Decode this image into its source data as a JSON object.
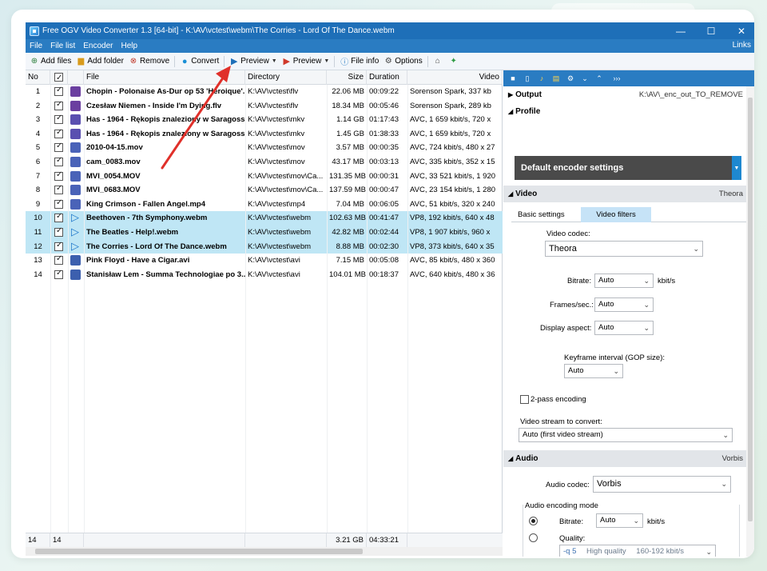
{
  "window": {
    "title": "Free OGV Video Converter 1.3  [64-bit] - K:\\AV\\vctest\\webm\\The Corries - Lord Of The Dance.webm"
  },
  "menu": {
    "items": [
      "File",
      "File list",
      "Encoder",
      "Help"
    ],
    "links": "Links"
  },
  "toolbar": {
    "add_files": "Add files",
    "add_folder": "Add folder",
    "remove": "Remove",
    "convert": "Convert",
    "preview1": "Preview",
    "preview2": "Preview",
    "file_info": "File info",
    "options": "Options"
  },
  "columns": {
    "no": "No",
    "file": "File",
    "directory": "Directory",
    "size": "Size",
    "duration": "Duration",
    "video": "Video"
  },
  "files": [
    {
      "no": "1",
      "file": "Chopin - Polonaise As-Dur op 53 'Heroique'...",
      "dir": "K:\\AV\\vctest\\flv",
      "size": "22.06 MB",
      "dur": "00:09:22",
      "video": "Sorenson Spark, 337 kb",
      "type": "flv"
    },
    {
      "no": "2",
      "file": "Czesław Niemen - Inside I'm Dying.flv",
      "dir": "K:\\AV\\vctest\\flv",
      "size": "18.34 MB",
      "dur": "00:05:46",
      "video": "Sorenson Spark, 289 kb",
      "type": "flv"
    },
    {
      "no": "3",
      "file": "Has - 1964 - Rękopis znaleziony w Saragossi...",
      "dir": "K:\\AV\\vctest\\mkv",
      "size": "1.14 GB",
      "dur": "01:17:43",
      "video": "AVC, 1 659 kbit/s, 720 x",
      "type": "mkv"
    },
    {
      "no": "4",
      "file": "Has - 1964 - Rękopis znaleziony w Saragossi...",
      "dir": "K:\\AV\\vctest\\mkv",
      "size": "1.45 GB",
      "dur": "01:38:33",
      "video": "AVC, 1 659 kbit/s, 720 x",
      "type": "mkv"
    },
    {
      "no": "5",
      "file": "2010-04-15.mov",
      "dir": "K:\\AV\\vctest\\mov",
      "size": "3.57 MB",
      "dur": "00:00:35",
      "video": "AVC, 724 kbit/s, 480 x 27",
      "type": "mov"
    },
    {
      "no": "6",
      "file": "cam_0083.mov",
      "dir": "K:\\AV\\vctest\\mov",
      "size": "43.17 MB",
      "dur": "00:03:13",
      "video": "AVC, 335 kbit/s, 352 x 15",
      "type": "mov"
    },
    {
      "no": "7",
      "file": "MVI_0054.MOV",
      "dir": "K:\\AV\\vctest\\mov\\Ca...",
      "size": "131.35 MB",
      "dur": "00:00:31",
      "video": "AVC, 33 521 kbit/s, 1 920",
      "type": "mov"
    },
    {
      "no": "8",
      "file": "MVI_0683.MOV",
      "dir": "K:\\AV\\vctest\\mov\\Ca...",
      "size": "137.59 MB",
      "dur": "00:00:47",
      "video": "AVC, 23 154 kbit/s, 1 280",
      "type": "mov"
    },
    {
      "no": "9",
      "file": "King Crimson - Fallen Angel.mp4",
      "dir": "K:\\AV\\vctest\\mp4",
      "size": "7.04 MB",
      "dur": "00:06:05",
      "video": "AVC, 51 kbit/s, 320 x 240",
      "type": "mov"
    },
    {
      "no": "10",
      "file": "Beethoven - 7th Symphony.webm",
      "dir": "K:\\AV\\vctest\\webm",
      "size": "102.63 MB",
      "dur": "00:41:47",
      "video": "VP8, 192 kbit/s, 640 x 48",
      "type": "webm"
    },
    {
      "no": "11",
      "file": "The Beatles - Help!.webm",
      "dir": "K:\\AV\\vctest\\webm",
      "size": "42.82 MB",
      "dur": "00:02:44",
      "video": "VP8, 1 907 kbit/s, 960 x",
      "type": "webm"
    },
    {
      "no": "12",
      "file": "The Corries - Lord Of The Dance.webm",
      "dir": "K:\\AV\\vctest\\webm",
      "size": "8.88 MB",
      "dur": "00:02:30",
      "video": "VP8, 373 kbit/s, 640 x 35",
      "type": "webm"
    },
    {
      "no": "13",
      "file": "Pink Floyd - Have a Cigar.avi",
      "dir": "K:\\AV\\vctest\\avi",
      "size": "7.15 MB",
      "dur": "00:05:08",
      "video": "AVC, 85 kbit/s, 480 x 360",
      "type": "avi"
    },
    {
      "no": "14",
      "file": "Stanisław Lem - Summa Technologiae po 3...",
      "dir": "K:\\AV\\vctest\\avi",
      "size": "104.01 MB",
      "dur": "00:18:37",
      "video": "AVC, 640 kbit/s, 480 x 36",
      "type": "avi"
    }
  ],
  "footer": {
    "count1": "14",
    "count2": "14",
    "total_size": "3.21 GB",
    "total_duration": "04:33:21"
  },
  "panel": {
    "output_label": "Output",
    "output_path": "K:\\AV\\_enc_out_TO_REMOVE",
    "profile_label": "Profile",
    "profile_value": "Default encoder settings",
    "video_label": "Video",
    "video_codec_name": "Theora",
    "tab_basic": "Basic settings",
    "tab_filters": "Video filters",
    "video_codec_label": "Video codec:",
    "video_codec_value": "Theora",
    "bitrate_label": "Bitrate:",
    "bitrate_value": "Auto",
    "bitrate_unit": "kbit/s",
    "fps_label": "Frames/sec.:",
    "fps_value": "Auto",
    "aspect_label": "Display aspect:",
    "aspect_value": "Auto",
    "keyframe_label": "Keyframe interval (GOP size):",
    "keyframe_value": "Auto",
    "twopass_label": "2-pass encoding",
    "stream_label": "Video stream to convert:",
    "stream_value": "Auto (first video stream)",
    "audio_label": "Audio",
    "audio_codec_name": "Vorbis",
    "audio_codec_label": "Audio codec:",
    "audio_codec_value": "Vorbis",
    "audio_mode_label": "Audio encoding mode",
    "a_bitrate_label": "Bitrate:",
    "a_bitrate_value": "Auto",
    "a_bitrate_unit": "kbit/s",
    "quality_label": "Quality:",
    "quality_q": "-q  5",
    "quality_desc": "High quality",
    "quality_range": "160-192 kbit/s"
  }
}
